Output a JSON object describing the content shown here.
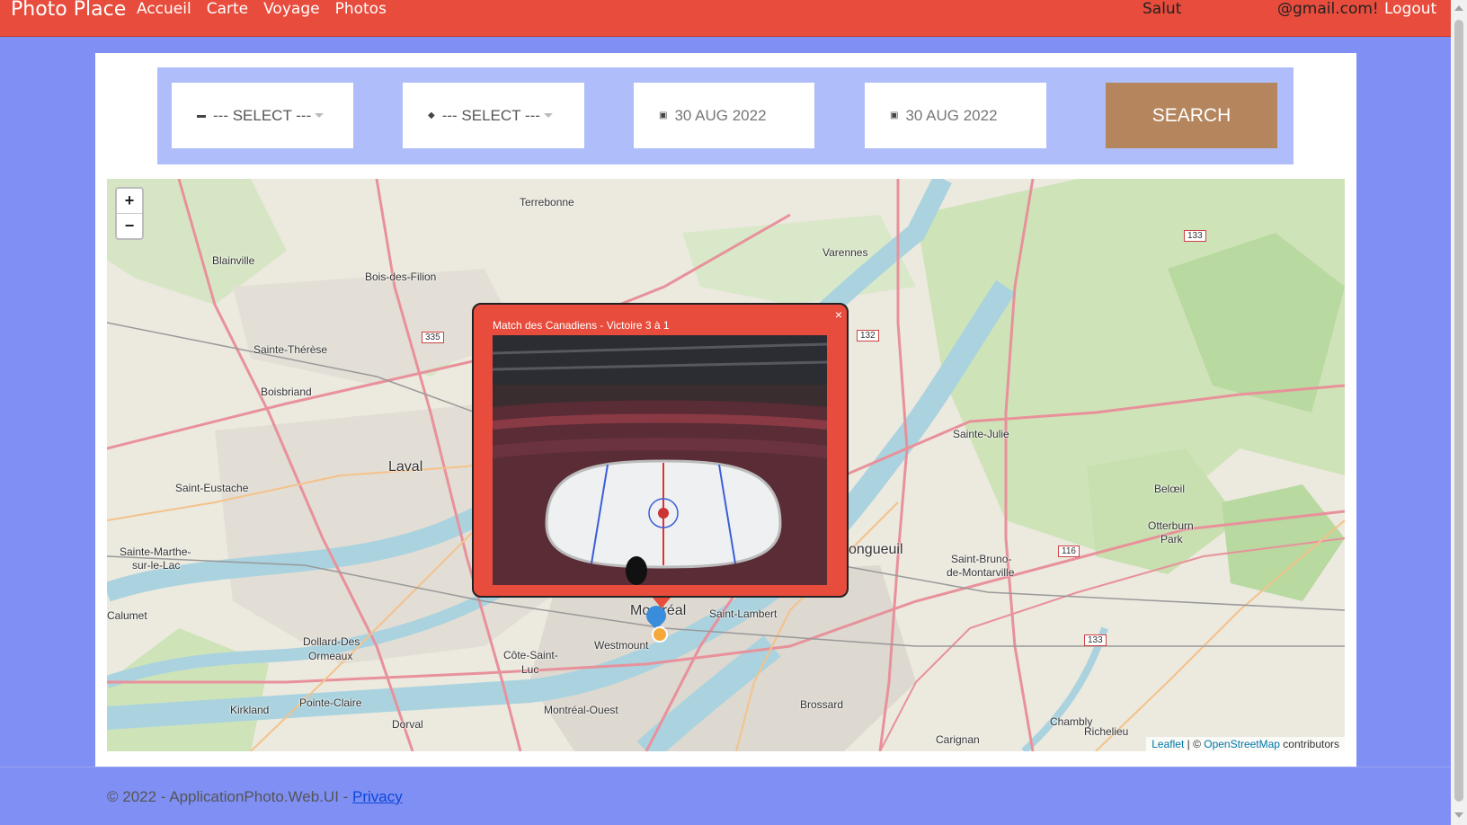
{
  "nav": {
    "brand": "Photo Place",
    "links": [
      "Accueil",
      "Carte",
      "Voyage",
      "Photos"
    ],
    "greeting": "Salut",
    "email": "@gmail.com!",
    "logout": "Logout"
  },
  "search": {
    "select1": "--- SELECT ---",
    "select2": "--- SELECT ---",
    "date_from": "30 AUG 2022",
    "date_to": "30 AUG 2022",
    "button": "SEARCH"
  },
  "map": {
    "zoom_in": "+",
    "zoom_out": "−",
    "attribution_leaflet": "Leaflet",
    "attribution_sep": " | © ",
    "attribution_osm": "OpenStreetMap",
    "attribution_tail": " contributors",
    "labels": {
      "terrebonne": "Terrebonne",
      "blainville": "Blainville",
      "bois_des_filion": "Bois-des-Filion",
      "varennes": "Varennes",
      "sainte_therese": "Sainte-Thérèse",
      "boisbriand": "Boisbriand",
      "laval": "Laval",
      "saint_eustache": "Saint-Eustache",
      "sainte_marthe": "Sainte-Marthe-",
      "sur_le_lac": "sur-le-Lac",
      "calumet": "Calumet",
      "dollard": "Dollard-Des",
      "ormeaux": "Ormeaux",
      "kirkland": "Kirkland",
      "pointe_claire": "Pointe-Claire",
      "dorval": "Dorval",
      "montreal_ouest": "Montréal-Ouest",
      "westmount": "Westmount",
      "cote_saint_luc_1": "Côte-Saint-",
      "cote_saint_luc_2": "Luc",
      "montreal": "Montréal",
      "saint_lambert": "Saint-Lambert",
      "longueuil": "ongueuil",
      "brossard": "Brossard",
      "sainte_julie": "Sainte-Julie",
      "saint_bruno_1": "Saint-Bruno-",
      "saint_bruno_2": "de-Montarville",
      "beloeil": "Belœil",
      "otterburn_1": "Otterburn",
      "otterburn_2": "Park",
      "chambly": "Chambly",
      "richelieu": "Richelieu",
      "carignan": "Carignan"
    },
    "shields": {
      "r335": "335",
      "r132": "132",
      "r133a": "133",
      "r133b": "133",
      "r116": "116"
    }
  },
  "popup": {
    "title": "Match des Canadiens - Victoire 3 à 1",
    "close": "×"
  },
  "footer": {
    "text": "© 2022 - ApplicationPhoto.Web.UI - ",
    "privacy": "Privacy"
  }
}
